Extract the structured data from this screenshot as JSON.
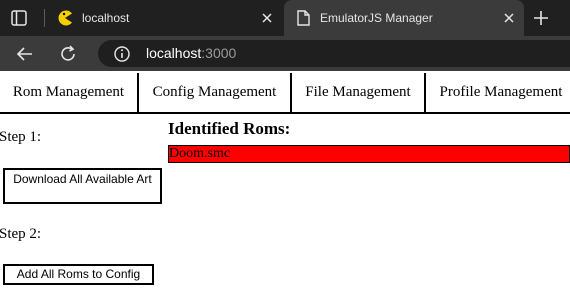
{
  "browser": {
    "tabs": [
      {
        "title": "localhost",
        "favicon": "pacman-icon",
        "active": false
      },
      {
        "title": "EmulatorJS Manager",
        "favicon": "page-icon",
        "active": true
      }
    ],
    "address": {
      "host": "localhost",
      "port": ":3000"
    }
  },
  "nav": {
    "items": [
      "Rom Management",
      "Config Management",
      "File Management",
      "Profile Management"
    ]
  },
  "steps": {
    "step1_label": "Step 1:",
    "download_art_label": "Download All Available Art",
    "step2_label": "Step 2:",
    "add_roms_label": "Add All Roms to Config"
  },
  "roms": {
    "heading": "Identified Roms:",
    "items": [
      {
        "name": "Doom.smc",
        "highlight_color": "#ff0000"
      }
    ]
  },
  "colors": {
    "chrome_dark": "#202020",
    "chrome_toolbar": "#3b3b3b",
    "rom_highlight": "#ff0000"
  }
}
